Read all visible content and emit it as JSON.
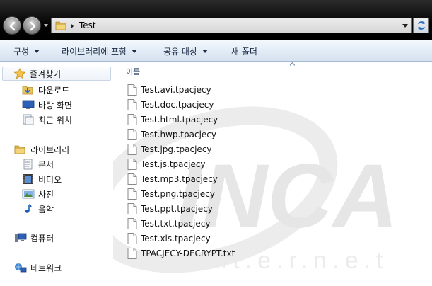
{
  "address": {
    "path_segment": "Test"
  },
  "toolbar": {
    "organize_label": "구성",
    "include_library_label": "라이브러리에 포함",
    "share_label": "공유 대상",
    "new_folder_label": "새 폴더"
  },
  "nav": {
    "favorites_label": "즐겨찾기",
    "favorites_items": [
      "다운로드",
      "바탕 화면",
      "최근 위치"
    ],
    "libraries_label": "라이브러리",
    "library_items": [
      "문서",
      "비디오",
      "사진",
      "음악"
    ],
    "computer_label": "컴퓨터",
    "network_label": "네트워크"
  },
  "content": {
    "column_name_label": "이름",
    "files": [
      "Test.avi.tpacjecy",
      "Test.doc.tpacjecy",
      "Test.html.tpacjecy",
      "Test.hwp.tpacjecy",
      "Test.jpg.tpacjecy",
      "Test.js.tpacjecy",
      "Test.mp3.tpacjecy",
      "Test.png.tpacjecy",
      "Test.ppt.tpacjecy",
      "Test.txt.tpacjecy",
      "Test.xls.tpacjecy",
      "TPACJECY-DECRYPT.txt"
    ]
  },
  "watermark": {
    "logo_text": "INCA",
    "sub_text": "I.n.t.e.r.n.e.t"
  },
  "colors": {
    "titlebar": "#000000",
    "toolbar": "#e3ecf6",
    "folder": "#e8c25a",
    "watermark": "#e6e6e6"
  }
}
